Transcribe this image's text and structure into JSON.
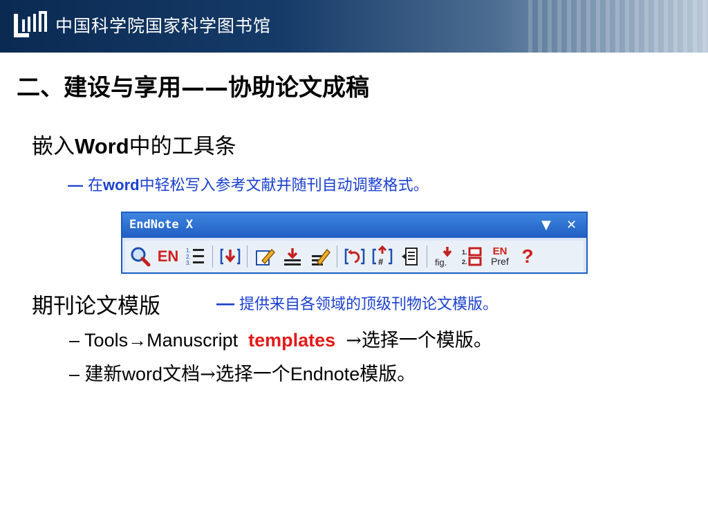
{
  "header": {
    "institution": "中国科学院国家科学图书馆"
  },
  "slide": {
    "title": "二、建设与享用——协助论文成稿",
    "section1": {
      "heading_pre": "嵌入",
      "heading_latin": "Word",
      "heading_post": "中的工具条",
      "dash": "—",
      "desc_pre": "在",
      "desc_bold": "word",
      "desc_post": "中轻松写入参考文献并随刊自动调整格式。"
    },
    "section2": {
      "heading": "期刊论文模版",
      "dash": "—",
      "desc": "提供来自各领域的顶级刊物论文模版。",
      "items": [
        {
          "dash": "–",
          "text_pre": "Tools→Manuscript",
          "highlight": "templates",
          "text_post": "→选择一个模版。"
        },
        {
          "dash": "–",
          "cjk1": "建新",
          "latin1": "word",
          "cjk2": "文档→选择一个",
          "latin2": "Endnote",
          "cjk3": "模版。"
        }
      ]
    }
  },
  "toolbar": {
    "title": "EndNote X",
    "dropdown": "▼",
    "close": "✕",
    "buttons": [
      {
        "name": "find-citation-icon",
        "label": ""
      },
      {
        "name": "go-to-endnote-icon",
        "label": "EN"
      },
      {
        "name": "format-bibliography-icon",
        "label": ""
      },
      {
        "name": "insert-citation-icon",
        "label": ""
      },
      {
        "name": "edit-citation-icon",
        "label": ""
      },
      {
        "name": "insert-selected-citation-icon",
        "label": ""
      },
      {
        "name": "edit-library-reference-icon",
        "label": ""
      },
      {
        "name": "unformat-citations-icon",
        "label": ""
      },
      {
        "name": "remove-field-codes-icon",
        "label": ""
      },
      {
        "name": "export-traveling-library-icon",
        "label": ""
      },
      {
        "name": "figure-icon",
        "label": "fig."
      },
      {
        "name": "generate-list-icon",
        "label": ""
      },
      {
        "name": "preferences-icon",
        "label_top": "EN",
        "label_bottom": "Pref"
      },
      {
        "name": "help-icon",
        "label": "?"
      }
    ]
  },
  "colors": {
    "banner_dark": "#0a2a52",
    "accent_blue": "#1a3fcf",
    "highlight_red": "#e21a1a",
    "toolbar_blue": "#1f5dc3"
  }
}
